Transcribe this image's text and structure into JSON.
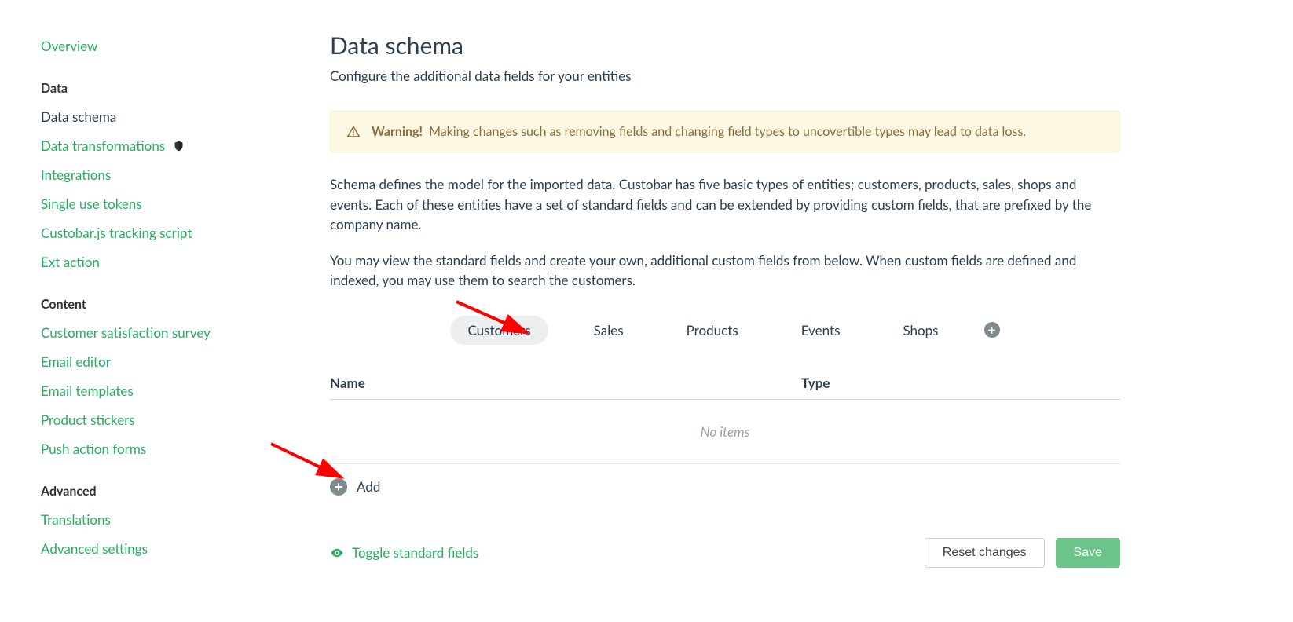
{
  "sidebar": {
    "overview": "Overview",
    "sections": [
      {
        "title": "Data",
        "items": [
          {
            "label": "Data schema",
            "current": true
          },
          {
            "label": "Data transformations",
            "shield": true
          },
          {
            "label": "Integrations"
          },
          {
            "label": "Single use tokens"
          },
          {
            "label": "Custobar.js tracking script"
          },
          {
            "label": "Ext action"
          }
        ]
      },
      {
        "title": "Content",
        "items": [
          {
            "label": "Customer satisfaction survey"
          },
          {
            "label": "Email editor"
          },
          {
            "label": "Email templates"
          },
          {
            "label": "Product stickers"
          },
          {
            "label": "Push action forms"
          }
        ]
      },
      {
        "title": "Advanced",
        "items": [
          {
            "label": "Translations"
          },
          {
            "label": "Advanced settings"
          }
        ]
      }
    ]
  },
  "page": {
    "title": "Data schema",
    "subtitle": "Configure the additional data fields for your entities",
    "warning_label": "Warning!",
    "warning_text": "Making changes such as removing fields and changing field types to uncovertible types may lead to data loss.",
    "para1": "Schema defines the model for the imported data. Custobar has five basic types of entities; customers, products, sales, shops and events. Each of these entities have a set of standard fields and can be extended by providing custom fields, that are prefixed by the company name.",
    "para2": "You may view the standard fields and create your own, additional custom fields from below. When custom fields are defined and indexed, you may use them to search the customers."
  },
  "tabs": {
    "items": [
      "Customers",
      "Sales",
      "Products",
      "Events",
      "Shops"
    ],
    "active": "Customers"
  },
  "table": {
    "col_name": "Name",
    "col_type": "Type",
    "empty": "No items"
  },
  "actions": {
    "add": "Add",
    "toggle": "Toggle standard fields",
    "reset": "Reset changes",
    "save": "Save"
  }
}
